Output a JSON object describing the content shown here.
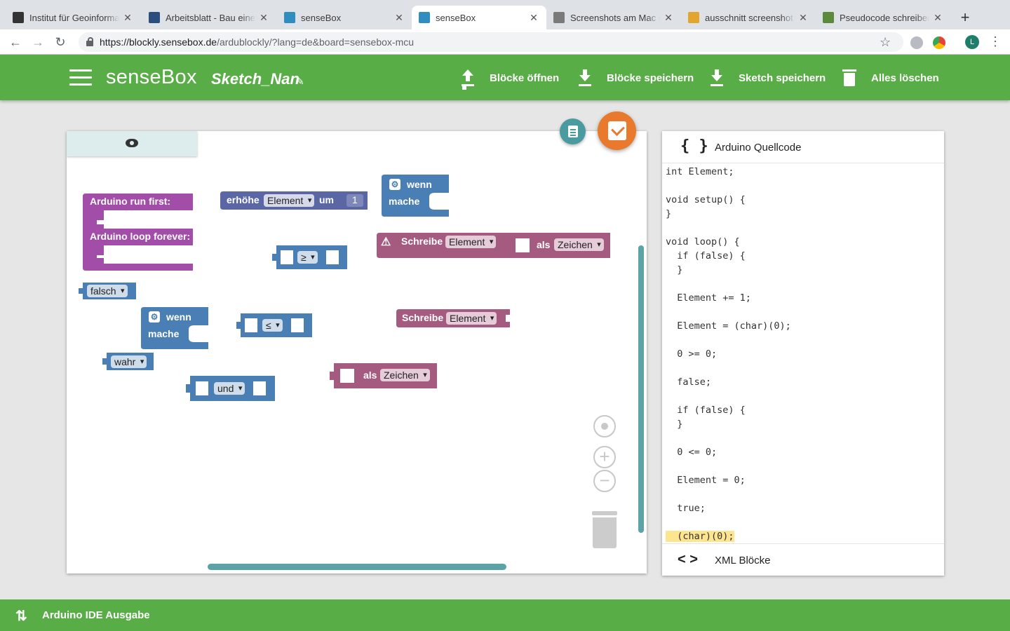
{
  "browser": {
    "tabs": [
      {
        "title": "Institut für Geoinforma",
        "favicon_color": "#333333",
        "active": false
      },
      {
        "title": "Arbeitsblatt - Bau eine",
        "favicon_color": "#2a4f7e",
        "active": false
      },
      {
        "title": "senseBox",
        "favicon_color": "#2e8ec1",
        "active": false
      },
      {
        "title": "senseBox",
        "favicon_color": "#2e8ec1",
        "active": true
      },
      {
        "title": "Screenshots am Mac e",
        "favicon_color": "#7a7a7a",
        "active": false
      },
      {
        "title": "ausschnitt screenshot",
        "favicon_color": "#e3a52b",
        "active": false
      },
      {
        "title": "Pseudocode schreiben",
        "favicon_color": "#5a8a3a",
        "active": false
      }
    ],
    "url_host": "https://blockly.sensebox.de",
    "url_path": "/ardublockly/?lang=de&board=sensebox-mcu",
    "profile_initial": "L"
  },
  "header": {
    "brand": "senseBox",
    "sketch_name": "Sketch_Nan",
    "buttons": {
      "open": "Blöcke öffnen",
      "save_blocks": "Blöcke speichern",
      "save_sketch": "Sketch speichern",
      "clear": "Alles löschen"
    }
  },
  "blocks": {
    "arduino_first": "Arduino run first:",
    "arduino_loop": "Arduino loop forever:",
    "increment_label": "erhöhe",
    "increment_var": "Element",
    "increment_by": "um",
    "increment_value": "1",
    "if1_wenn": "wenn",
    "if1_mache": "mache",
    "set1_label": "Schreibe",
    "set1_var": "Element",
    "cast1_label": "als",
    "cast1_type": "Zeichen",
    "compare_ge": "≥",
    "false_value": "falsch",
    "if2_wenn": "wenn",
    "if2_mache": "mache",
    "compare_le": "≤",
    "set2_label": "Schreibe",
    "set2_var": "Element",
    "true_value": "wahr",
    "logic_and": "und",
    "cast2_label": "als",
    "cast2_type": "Zeichen"
  },
  "code_panel": {
    "title": "Arduino Quellcode",
    "footer": "XML Blöcke",
    "lines": [
      "int Element;",
      "",
      "void setup() {",
      "}",
      "",
      "void loop() {",
      "  if (false) {",
      "  }",
      "",
      "  Element += 1;",
      "",
      "  Element = (char)(0);",
      "",
      "  0 >= 0;",
      "",
      "  false;",
      "",
      "  if (false) {",
      "  }",
      "",
      "  0 <= 0;",
      "",
      "  Element = 0;",
      "",
      "  true;",
      "",
      "  (char)(0);"
    ]
  },
  "bottom": {
    "title": "Arduino IDE Ausgabe"
  },
  "colors": {
    "green": "#59ad46",
    "block_purple": "#a24ea8",
    "block_indigo": "#5b67a5",
    "block_logic": "#4a7fb5",
    "block_variable": "#a55b80",
    "block_teal": "#4a9b9f",
    "fab_orange": "#e8792d"
  }
}
